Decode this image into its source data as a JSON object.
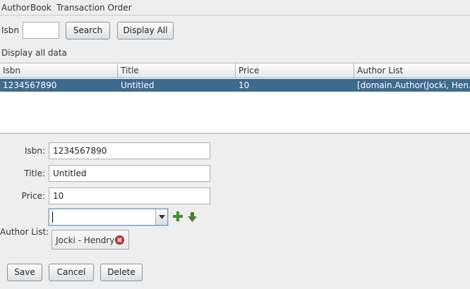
{
  "menu": [
    "Author",
    "Book",
    "Transaction Order"
  ],
  "search": {
    "label": "Isbn",
    "value": "",
    "search_button": "Search",
    "display_all_button": "Display All"
  },
  "status_text": "Display all data",
  "table": {
    "columns": [
      "Isbn",
      "Title",
      "Price",
      "Author List"
    ],
    "rows": [
      [
        "1234567890",
        "Untitled",
        "10",
        "[domain.Author(Jocki, Hen..."
      ]
    ],
    "selected_row": 0
  },
  "form": {
    "isbn_label": "Isbn:",
    "isbn_value": "1234567890",
    "title_label": "Title:",
    "title_value": "Untitled",
    "price_label": "Price:",
    "price_value": "10",
    "author_list_label": "Author List:",
    "author_combo_value": "",
    "authors": [
      "Jocki - Hendry"
    ]
  },
  "buttons": {
    "save": "Save",
    "cancel": "Cancel",
    "delete": "Delete"
  },
  "colors": {
    "selection": "#3d6a8f",
    "add_icon": "#3f8f2f",
    "remove_icon": "#c83a3a"
  },
  "icons": {
    "add": "plus-icon",
    "move_down": "arrow-down-icon",
    "remove": "remove-circle-icon"
  }
}
